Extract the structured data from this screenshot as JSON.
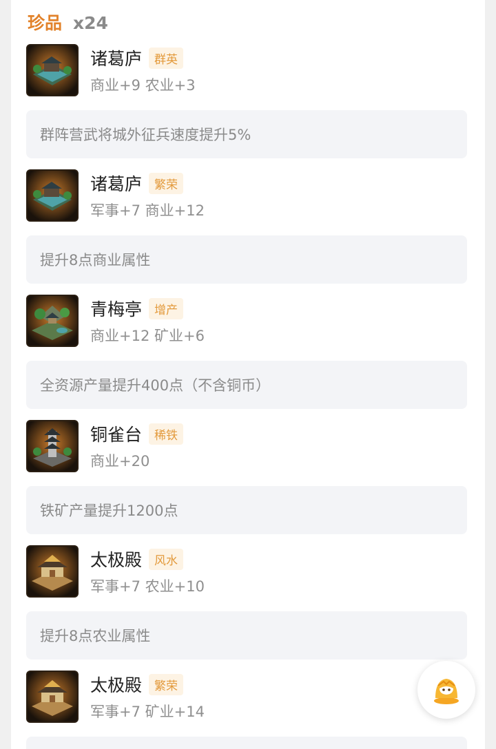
{
  "section": {
    "title": "珍品",
    "count": "x24"
  },
  "items": [
    {
      "name": "诸葛庐",
      "tag": "群英",
      "stats": "商业+9 农业+3",
      "desc": "群阵营武将城外征兵速度提升5%",
      "icon": "thatched-hut-icon"
    },
    {
      "name": "诸葛庐",
      "tag": "繁荣",
      "stats": "军事+7 商业+12",
      "desc": "提升8点商业属性",
      "icon": "thatched-hut-icon"
    },
    {
      "name": "青梅亭",
      "tag": "增产",
      "stats": "商业+12 矿业+6",
      "desc": "全资源产量提升400点（不含铜币）",
      "icon": "pavilion-icon"
    },
    {
      "name": "铜雀台",
      "tag": "稀铁",
      "stats": "商业+20",
      "desc": "铁矿产量提升1200点",
      "icon": "pagoda-tower-icon"
    },
    {
      "name": "太极殿",
      "tag": "风水",
      "stats": "军事+7 农业+10",
      "desc": "提升8点农业属性",
      "icon": "palace-icon"
    },
    {
      "name": "太极殿",
      "tag": "繁荣",
      "stats": "军事+7 矿业+14",
      "desc": "",
      "icon": "palace-icon"
    }
  ],
  "colors": {
    "accent": "#e2822a",
    "tag_bg": "#fdf3e4",
    "tag_text": "#e39a3c",
    "desc_bg": "#f3f4f7"
  },
  "fab": {
    "icon": "assistant-mascot-icon"
  }
}
